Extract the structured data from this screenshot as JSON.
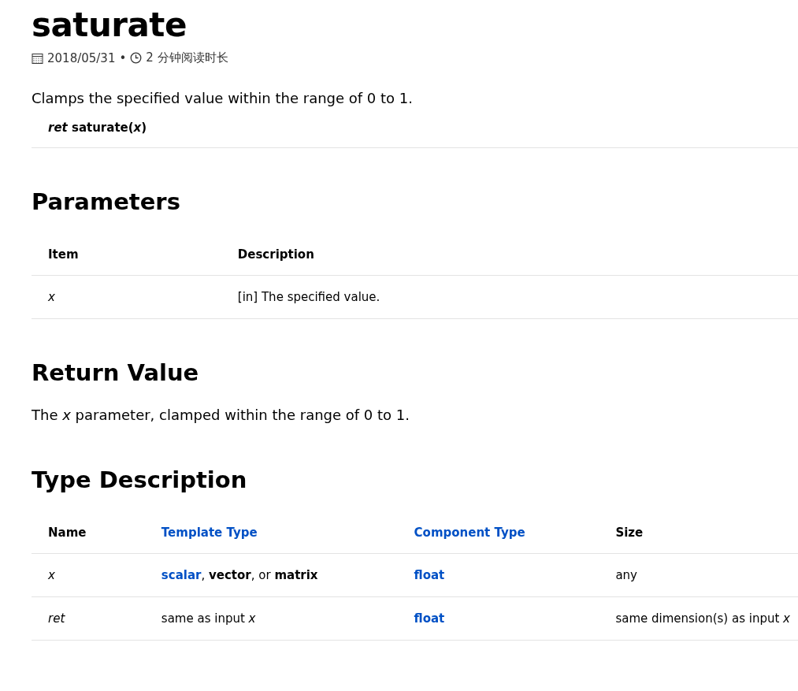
{
  "title": "saturate",
  "meta": {
    "date": "2018/05/31",
    "separator": "•",
    "reading_time": "2 分钟阅读时长"
  },
  "summary": "Clamps the specified value within the range of 0 to 1.",
  "syntax": "*ret* saturate(*x*)",
  "sections": [
    {
      "heading": "Parameters",
      "table": {
        "columns": [
          {
            "label": "Item",
            "link": false
          },
          {
            "label": "Description",
            "link": false
          }
        ],
        "rows": [
          [
            [
              {
                "kind": "italic",
                "text": "x"
              }
            ],
            [
              {
                "kind": "text",
                "text": "[in] The specified value."
              }
            ]
          ]
        ]
      }
    },
    {
      "heading": "Return Value",
      "paragraph": "The *x* parameter, clamped within the range of 0 to 1."
    },
    {
      "heading": "Type Description",
      "table": {
        "columns": [
          {
            "label": "Name",
            "link": false
          },
          {
            "label": "Template Type",
            "link": true
          },
          {
            "label": "Component Type",
            "link": true
          },
          {
            "label": "Size",
            "link": false
          }
        ],
        "rows": [
          [
            [
              {
                "kind": "italic",
                "text": "x"
              }
            ],
            [
              {
                "kind": "link",
                "text": "scalar"
              },
              {
                "kind": "text",
                "text": ", **vector**, or **matrix**"
              }
            ],
            [
              {
                "kind": "link",
                "text": "float"
              }
            ],
            [
              {
                "kind": "text",
                "text": "any"
              }
            ]
          ],
          [
            [
              {
                "kind": "italic",
                "text": "ret"
              }
            ],
            [
              {
                "kind": "text",
                "text": "same as input *x*"
              }
            ],
            [
              {
                "kind": "link",
                "text": "float"
              }
            ],
            [
              {
                "kind": "text",
                "text": "same dimension(s) as input *x*"
              }
            ]
          ]
        ]
      }
    }
  ]
}
